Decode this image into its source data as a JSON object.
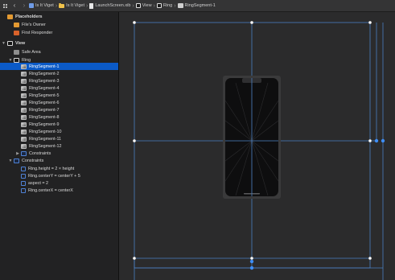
{
  "jumpbar": {
    "back_icon": "chevron-left-icon",
    "forward_icon": "chevron-right-icon",
    "crumbs": [
      {
        "label": "Is It Viget",
        "icon": "app-icon"
      },
      {
        "label": "Is It Viget",
        "icon": "folder-icon"
      },
      {
        "label": "LaunchScreen.xib",
        "icon": "xib-file-icon"
      },
      {
        "label": "View",
        "icon": "view-icon"
      },
      {
        "label": "Ring",
        "icon": "view-icon"
      },
      {
        "label": "RingSegment-1",
        "icon": "image-view-icon"
      }
    ]
  },
  "outline": {
    "placeholders": "Placeholders",
    "files_owner": "File's Owner",
    "first_responder": "First Responder",
    "view": "View",
    "safe_area": "Safe Area",
    "ring": "Ring",
    "segments": [
      "RingSegment-1",
      "RingSegment-2",
      "RingSegment-3",
      "RingSegment-4",
      "RingSegment-5",
      "RingSegment-6",
      "RingSegment-7",
      "RingSegment-8",
      "RingSegment-9",
      "RingSegment-10",
      "RingSegment-11",
      "RingSegment-12"
    ],
    "ring_constraints": "Constraints",
    "view_constraints": "Constraints",
    "constraints": [
      "Ring.height = 2 × height",
      "Ring.centerY = centerY + 5",
      "aspect = 2",
      "Ring.centerX = centerX"
    ]
  },
  "colors": {
    "selection": "#0b5ac7",
    "guide": "#4a7fc1",
    "handle": "#3e8ef7"
  }
}
